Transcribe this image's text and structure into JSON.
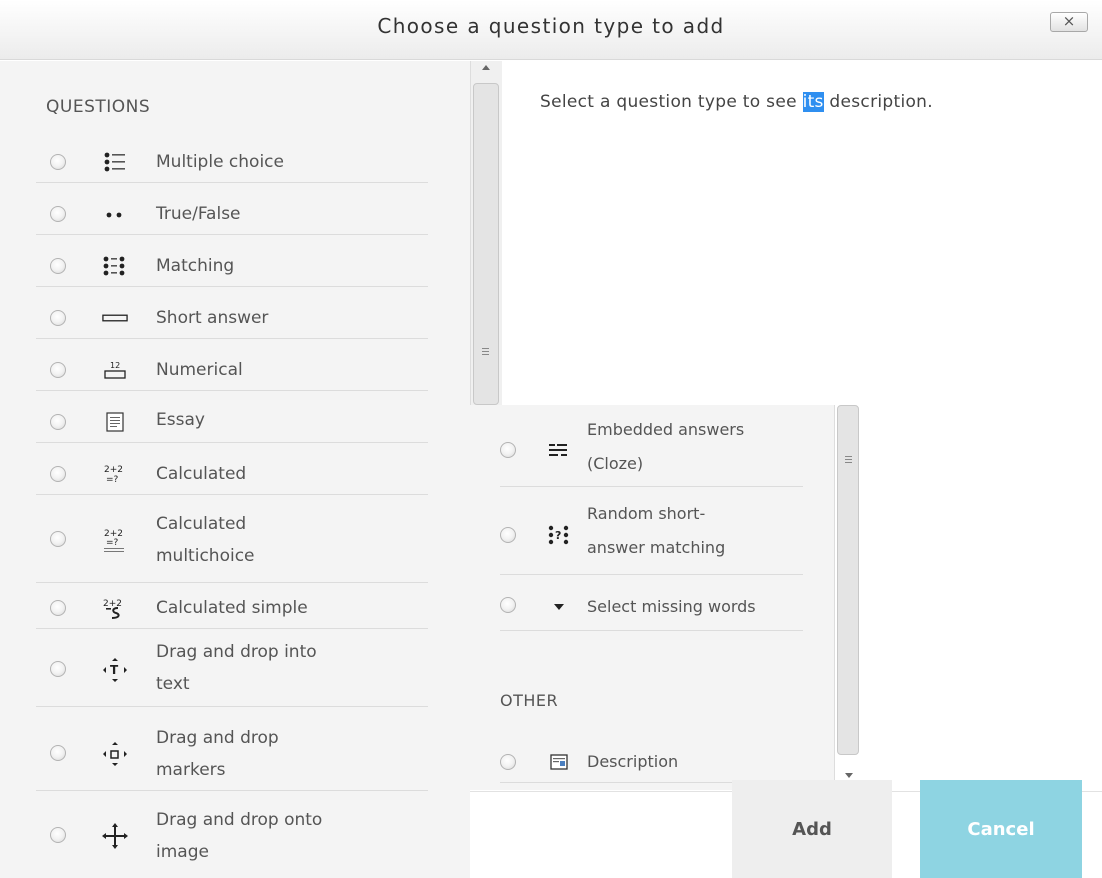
{
  "dialog": {
    "title": "Choose a question type to add",
    "close_label": "×"
  },
  "questions": {
    "header": "QUESTIONS",
    "items": [
      {
        "line1": "Multiple choice",
        "line2": "",
        "icon": "multiple-choice-icon"
      },
      {
        "line1": "True/False",
        "line2": "",
        "icon": "true-false-icon"
      },
      {
        "line1": "Matching",
        "line2": "",
        "icon": "matching-icon"
      },
      {
        "line1": "Short answer",
        "line2": "",
        "icon": "short-answer-icon"
      },
      {
        "line1": "Numerical",
        "line2": "",
        "icon": "numerical-icon"
      },
      {
        "line1": "Essay",
        "line2": "",
        "icon": "essay-icon"
      },
      {
        "line1": "Calculated",
        "line2": "",
        "icon": "calculated-icon"
      },
      {
        "line1": "Calculated",
        "line2": "multichoice",
        "icon": "calculated-multichoice-icon"
      },
      {
        "line1": "Calculated simple",
        "line2": "",
        "icon": "calculated-simple-icon"
      },
      {
        "line1": "Drag and drop into",
        "line2": "text",
        "icon": "drag-drop-text-icon"
      },
      {
        "line1": "Drag and drop",
        "line2": "markers",
        "icon": "drag-drop-markers-icon"
      },
      {
        "line1": "Drag and drop onto",
        "line2": "image",
        "icon": "drag-drop-image-icon"
      }
    ]
  },
  "more_questions": {
    "items": [
      {
        "line1": "Embedded answers",
        "line2": "(Cloze)",
        "icon": "cloze-icon"
      },
      {
        "line1": "Random short-",
        "line2": "answer matching",
        "icon": "random-matching-icon"
      },
      {
        "line1": "Select missing words",
        "line2": "",
        "icon": "dropdown-arrow-icon"
      }
    ]
  },
  "other": {
    "header": "OTHER",
    "items": [
      {
        "line1": "Description",
        "line2": "",
        "icon": "description-icon"
      }
    ]
  },
  "description": {
    "before": "Select a question type to see ",
    "highlight": "its",
    "after": " description."
  },
  "buttons": {
    "add": "Add",
    "cancel": "Cancel"
  },
  "colors": {
    "highlight": "#2f8ff0",
    "cancel_button": "#8ed4e2",
    "add_button": "#eeeeee"
  }
}
